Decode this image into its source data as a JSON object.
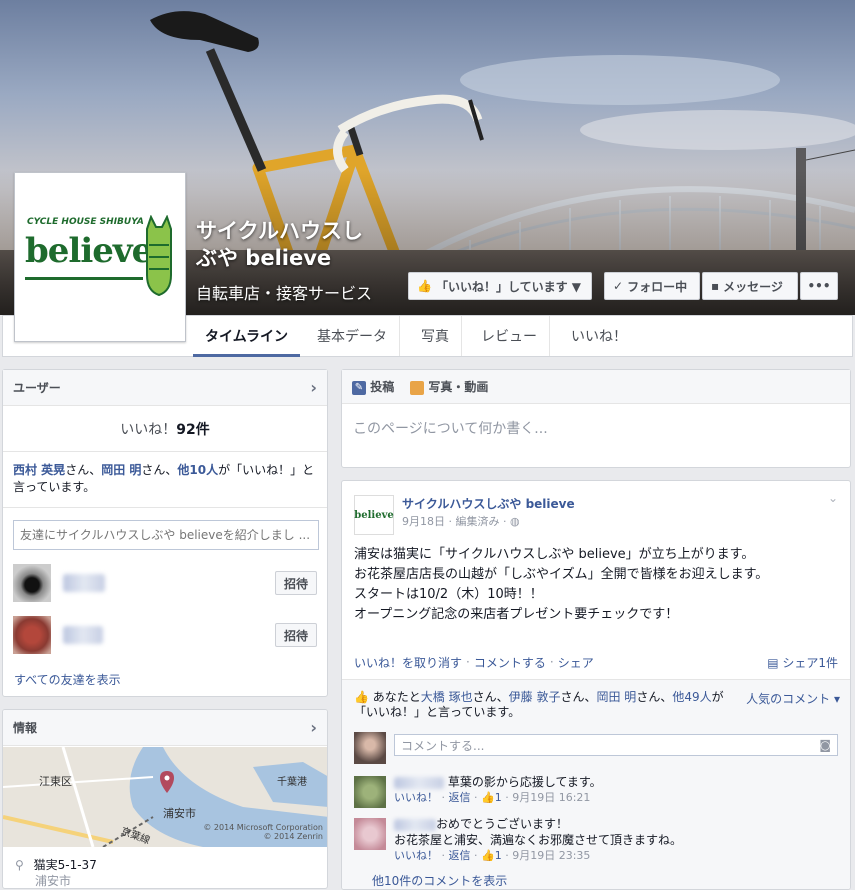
{
  "page": {
    "name_line1": "サイクルハウスし",
    "name_line2": "ぶや believe",
    "category": "自転車店・接客サービス",
    "logo": {
      "small": "CYCLE HOUSE SHIBUYA",
      "big": "believe"
    }
  },
  "actions": {
    "liked": "「いいね！」しています ▼",
    "follow": "フォロー中",
    "message": "メッセージ",
    "more": "•••"
  },
  "tabs": [
    "タイムライン",
    "基本データ",
    "写真",
    "レビュー",
    "いいね！"
  ],
  "people": {
    "title": "ユーザー",
    "likes_label": "いいね！",
    "likes_count": "92件",
    "friend1": "西村 英晃",
    "sep1": "さん、",
    "friend2": "岡田 明",
    "sep2": "さん、",
    "others": "他10人",
    "tail": "が「いいね！」と言っています。",
    "invite_placeholder": "友達にサイクルハウスしぶや believeを紹介しまし ...",
    "invite_label": "招待",
    "see_all": "すべての友達を表示"
  },
  "info": {
    "title": "情報",
    "map_labels": {
      "ward": "江東区",
      "city": "浦安市",
      "station": "千葉港",
      "line": "京葉線"
    },
    "copyright1": "© 2014 Microsoft Corporation",
    "copyright2": "© 2014 Zenrin",
    "address": "猫実5-1-37",
    "address2": "浦安市"
  },
  "composer": {
    "post_tab": "投稿",
    "photo_tab": "写真・動画",
    "placeholder": "このページについて何か書く..."
  },
  "post": {
    "author": "サイクルハウスしぶや believe",
    "date": "9月18日",
    "edited": "· 編集済み ·",
    "lines": [
      "浦安は猫実に「サイクルハウスしぶや believe」が立ち上がります。",
      "お花茶屋店店長の山越が「しぶやイズム」全開で皆様をお迎えします。",
      "スタートは10/2（木）10時！！",
      "オープニング記念の来店者プレゼント要チェックです！"
    ],
    "unlike": "いいね！を取り消す",
    "comment": "コメントする",
    "share": "シェア",
    "share_count": "シェア1件",
    "likes_prefix": "あなたと",
    "likes_name1": "大橋 琢也",
    "likes_name2": "伊藤 敦子",
    "likes_name3": "岡田 明",
    "likes_others": "他49人",
    "likes_suffix": "が「いいね！」と言っています。",
    "top_comments": "人気のコメント ▾",
    "comment_placeholder": "コメントする...",
    "c1_text": "草葉の影から応援してます。",
    "c1_like": "いいね！",
    "c1_reply": "返信",
    "c1_count": "1",
    "c1_time": "9月19日 16:21",
    "c2_text1": "おめでとうございます！",
    "c2_text2": "お花茶屋と浦安、満遍なくお邪魔させて頂きますね。",
    "c2_like": "いいね！",
    "c2_reply": "返信",
    "c2_count": "1",
    "c2_time": "9月19日 23:35",
    "more_comments": "他10件のコメントを表示"
  }
}
